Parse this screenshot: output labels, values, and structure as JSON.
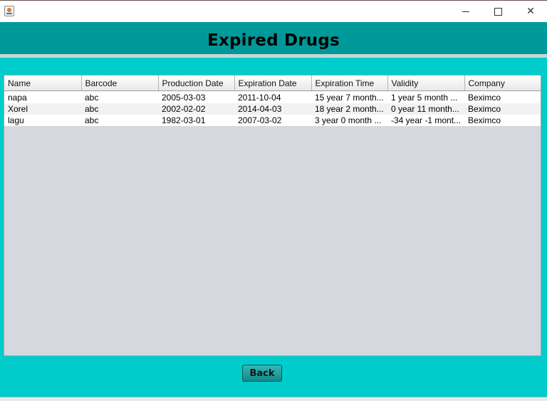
{
  "window": {
    "icons": {
      "app": "java-cup-icon",
      "minimize": "minimize-icon",
      "maximize": "maximize-icon",
      "close": "close-icon"
    }
  },
  "header": {
    "title": "Expired Drugs"
  },
  "colors": {
    "header_bg": "#009999",
    "content_bg": "#00cccc",
    "panel_bg": "#d5d8df"
  },
  "table": {
    "columns": [
      "Name",
      "Barcode",
      "Production Date",
      "Expiration Date",
      "Expiration Time",
      "Validity",
      "Company"
    ],
    "rows": [
      [
        "napa",
        "abc",
        "2005-03-03",
        "2011-10-04",
        "15 year 7 month...",
        "1 year 5 month ...",
        "Beximco"
      ],
      [
        "Xorel",
        "abc",
        "2002-02-02",
        "2014-04-03",
        "18 year 2 month...",
        "0 year 11 month...",
        "Beximco"
      ],
      [
        "lagu",
        "abc",
        "1982-03-01",
        "2007-03-02",
        "3 year 0 month ...",
        "-34 year -1 mont...",
        "Beximco"
      ]
    ]
  },
  "back_button": {
    "label": "Back"
  }
}
